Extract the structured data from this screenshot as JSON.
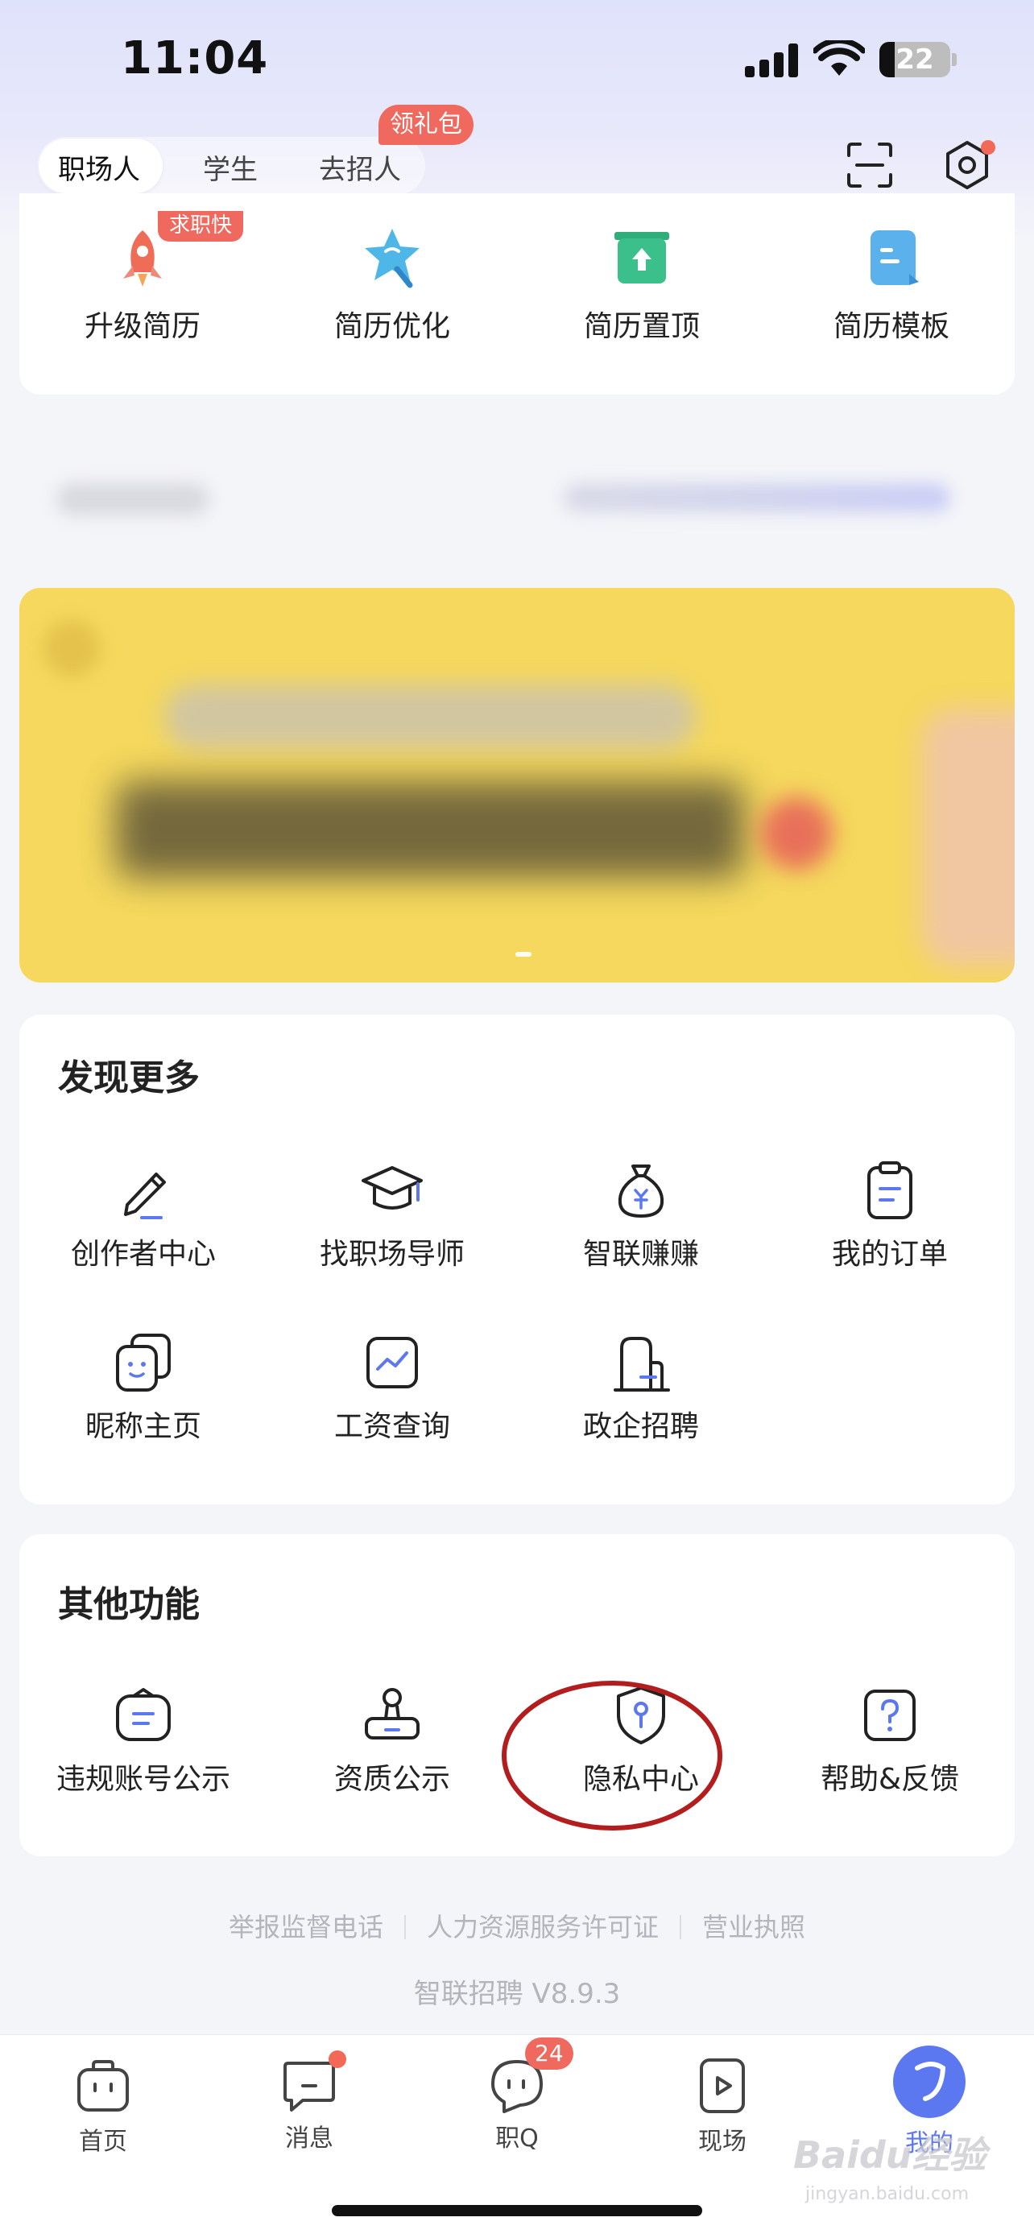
{
  "status_bar": {
    "time": "11:04",
    "battery": "22"
  },
  "header": {
    "segments": [
      "职场人",
      "学生",
      "去招人"
    ],
    "active_segment": "职场人",
    "gift_badge": "领礼包"
  },
  "quick_actions": {
    "badge": "求职快",
    "items": [
      {
        "label": "升级简历",
        "icon": "rocket-icon"
      },
      {
        "label": "简历优化",
        "icon": "star-wand-icon"
      },
      {
        "label": "简历置顶",
        "icon": "pin-top-icon"
      },
      {
        "label": "简历模板",
        "icon": "template-icon"
      }
    ]
  },
  "discover": {
    "title": "发现更多",
    "items": [
      {
        "label": "创作者中心",
        "icon": "pencil-icon"
      },
      {
        "label": "找职场导师",
        "icon": "graduation-cap-icon"
      },
      {
        "label": "智联赚赚",
        "icon": "money-bag-icon"
      },
      {
        "label": "我的订单",
        "icon": "clipboard-icon"
      },
      {
        "label": "昵称主页",
        "icon": "face-card-icon"
      },
      {
        "label": "工资查询",
        "icon": "chart-line-icon"
      },
      {
        "label": "政企招聘",
        "icon": "building-icon"
      }
    ]
  },
  "other": {
    "title": "其他功能",
    "items": [
      {
        "label": "违规账号公示",
        "icon": "notice-bag-icon"
      },
      {
        "label": "资质公示",
        "icon": "stamp-icon"
      },
      {
        "label": "隐私中心",
        "icon": "shield-key-icon"
      },
      {
        "label": "帮助&反馈",
        "icon": "help-icon"
      }
    ]
  },
  "footer": {
    "links": [
      "举报监督电话",
      "人力资源服务许可证",
      "营业执照"
    ],
    "version": "智联招聘 V8.9.3"
  },
  "tabbar": {
    "items": [
      {
        "label": "首页",
        "icon": "briefcase-icon"
      },
      {
        "label": "消息",
        "icon": "message-icon"
      },
      {
        "label": "职Q",
        "icon": "chat-bubble-icon",
        "badge": "24"
      },
      {
        "label": "现场",
        "icon": "video-icon"
      },
      {
        "label": "我的",
        "icon": "profile-icon"
      }
    ],
    "active": "我的"
  },
  "colors": {
    "accent": "#5b78f0",
    "badge_red": "#f0695e",
    "annotation_red": "#b31d1d"
  },
  "watermark": {
    "brand": "Baidu经验",
    "url": "jingyan.baidu.com"
  }
}
